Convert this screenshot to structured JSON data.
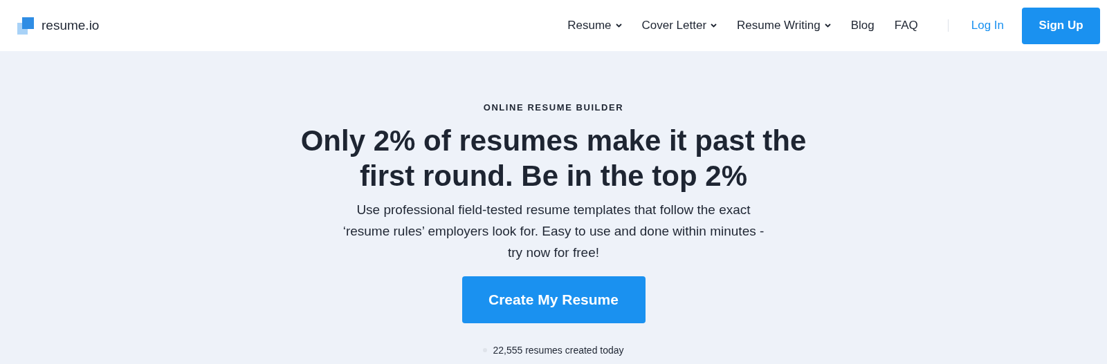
{
  "header": {
    "logo": "resume.io",
    "nav": [
      {
        "label": "Resume",
        "dropdown": true
      },
      {
        "label": "Cover Letter",
        "dropdown": true
      },
      {
        "label": "Resume Writing",
        "dropdown": true
      },
      {
        "label": "Blog",
        "dropdown": false
      },
      {
        "label": "FAQ",
        "dropdown": false
      }
    ],
    "login": "Log In",
    "signup": "Sign Up"
  },
  "hero": {
    "eyebrow": "ONLINE RESUME BUILDER",
    "title": "Only 2% of resumes make it past the first round. Be in the top 2%",
    "subtitle": "Use professional field-tested resume templates that follow the exact ‘resume rules’ employers look for. Easy to use and done within minutes - try now for free!",
    "cta": "Create My Resume",
    "counter": "22,555 resumes created today"
  }
}
